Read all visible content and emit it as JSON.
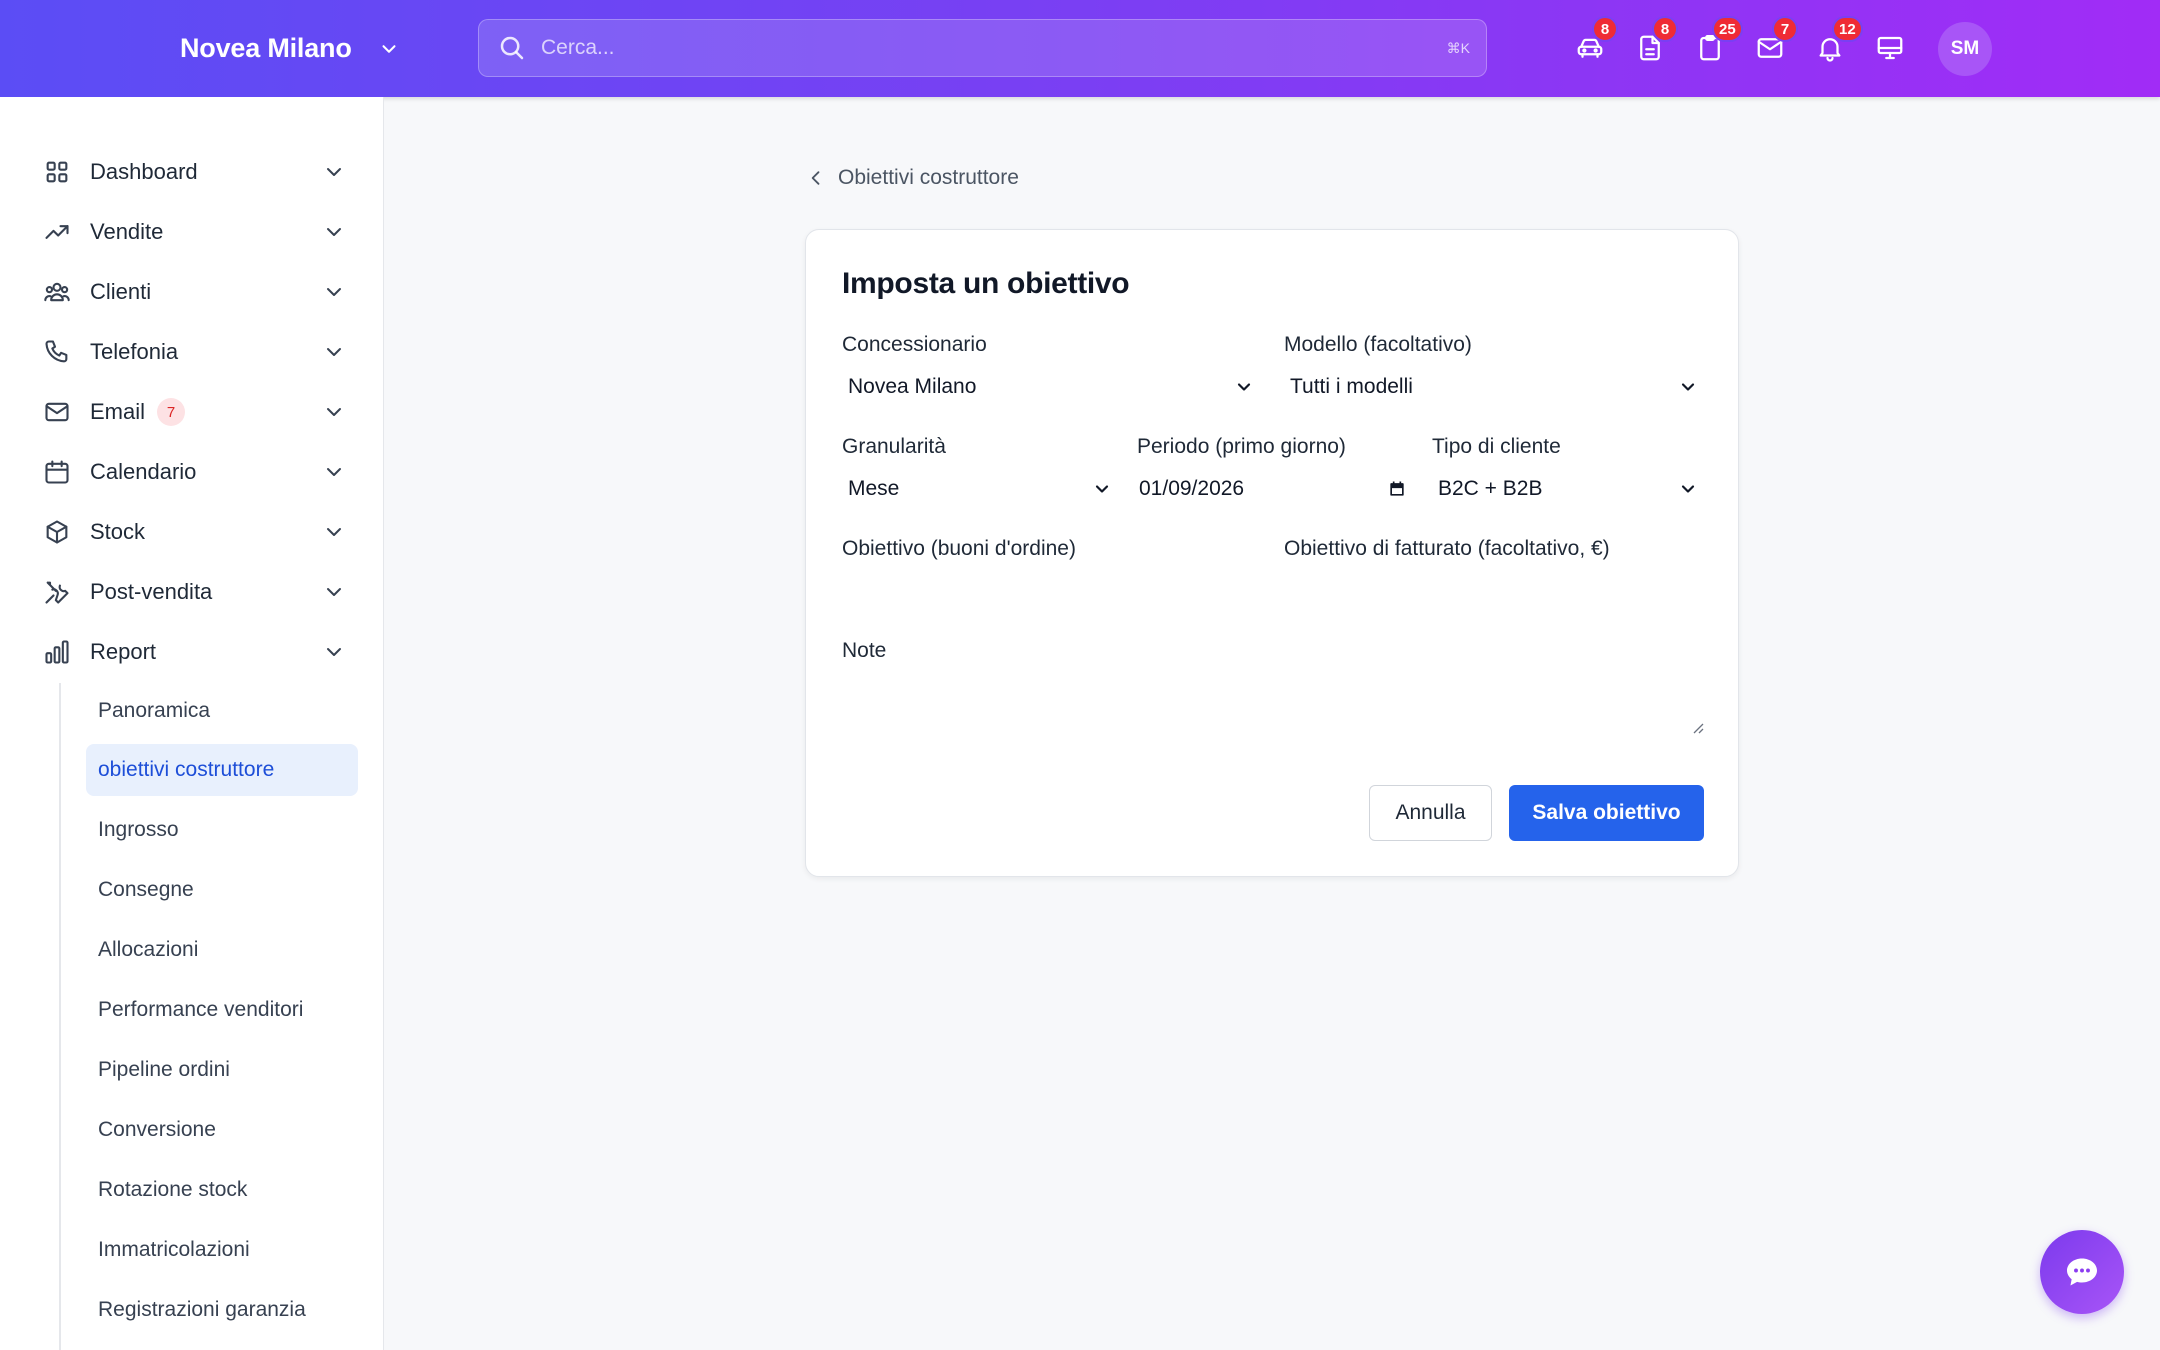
{
  "header": {
    "brand": "Novea Milano",
    "search_placeholder": "Cerca...",
    "search_shortcut": "⌘K",
    "icons": [
      {
        "name": "car-icon",
        "badge": "8"
      },
      {
        "name": "document-icon",
        "badge": "8"
      },
      {
        "name": "clipboard-icon",
        "badge": "25"
      },
      {
        "name": "mail-icon",
        "badge": "7"
      },
      {
        "name": "bell-icon",
        "badge": "12"
      },
      {
        "name": "monitor-icon",
        "badge": ""
      }
    ],
    "avatar_initials": "SM"
  },
  "sidebar": {
    "items": [
      {
        "label": "Dashboard",
        "icon": "grid-icon"
      },
      {
        "label": "Vendite",
        "icon": "trend-up-icon"
      },
      {
        "label": "Clienti",
        "icon": "users-icon"
      },
      {
        "label": "Telefonia",
        "icon": "phone-icon"
      },
      {
        "label": "Email",
        "icon": "mail-icon",
        "badge": "7"
      },
      {
        "label": "Calendario",
        "icon": "calendar-icon"
      },
      {
        "label": "Stock",
        "icon": "cube-icon"
      },
      {
        "label": "Post-vendita",
        "icon": "tools-icon"
      },
      {
        "label": "Report",
        "icon": "bar-chart-icon"
      }
    ],
    "report_subitems": [
      "Panoramica",
      "obiettivi costruttore",
      "Ingrosso",
      "Consegne",
      "Allocazioni",
      "Performance venditori",
      "Pipeline ordini",
      "Conversione",
      "Rotazione stock",
      "Immatricolazioni",
      "Registrazioni garanzia"
    ],
    "active_subitem": "obiettivi costruttore"
  },
  "breadcrumb": "Obiettivi costruttore",
  "form": {
    "title": "Imposta un obiettivo",
    "dealer_label": "Concessionario",
    "dealer_value": "Novea Milano",
    "model_label": "Modello (facoltativo)",
    "model_value": "Tutti i modelli",
    "granularity_label": "Granularità",
    "granularity_value": "Mese",
    "period_label": "Periodo (primo giorno)",
    "period_value": "01/09/2026",
    "customer_type_label": "Tipo di cliente",
    "customer_type_value": "B2C + B2B",
    "orders_target_label": "Obiettivo (buoni d'ordine)",
    "orders_target_value": "",
    "revenue_target_label": "Obiettivo di fatturato (facoltativo, €)",
    "revenue_target_value": "",
    "notes_label": "Note",
    "notes_value": "",
    "cancel_label": "Annulla",
    "save_label": "Salva obiettivo"
  },
  "colors": {
    "header_gradient_start": "#5b4df5",
    "header_gradient_end": "#a12cf6",
    "primary": "#2563eb",
    "badge_red": "#ef2b35",
    "active_bg": "#e8f0fd"
  }
}
